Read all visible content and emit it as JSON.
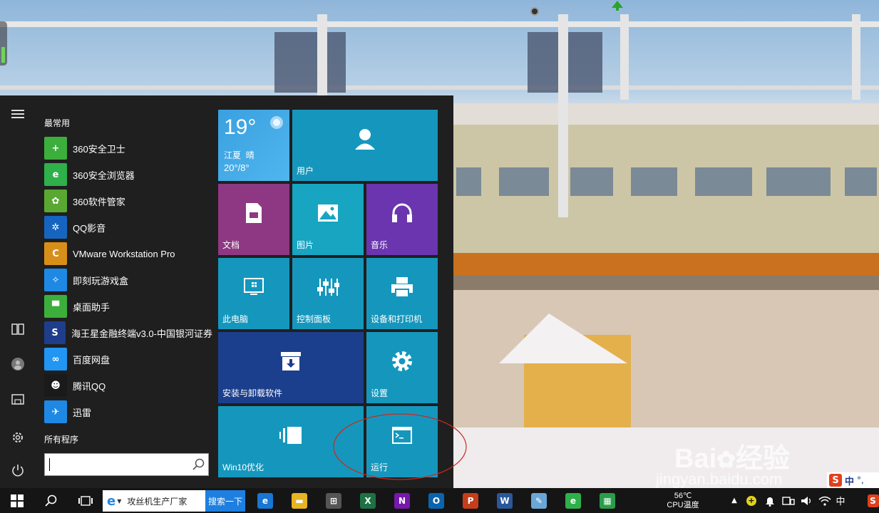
{
  "start_menu": {
    "most_used_heading": "最常用",
    "all_programs_label": "所有程序",
    "apps": [
      {
        "label": "360安全卫士",
        "icon": "360-safe-guard-icon",
        "color": "#3cae3c",
        "glyph": "+"
      },
      {
        "label": "360安全浏览器",
        "icon": "360-browser-icon",
        "color": "#2fb04a",
        "glyph": "e"
      },
      {
        "label": "360软件管家",
        "icon": "360-software-manager-icon",
        "color": "#5aa832",
        "glyph": "✿"
      },
      {
        "label": "QQ影音",
        "icon": "qq-player-icon",
        "color": "#1565c0",
        "glyph": "✲"
      },
      {
        "label": "VMware Workstation Pro",
        "icon": "vmware-icon",
        "color": "#d88f1a",
        "glyph": "C"
      },
      {
        "label": "即刻玩游戏盒",
        "icon": "game-box-icon",
        "color": "#1e88e5",
        "glyph": "✧"
      },
      {
        "label": "桌面助手",
        "icon": "desktop-assistant-icon",
        "color": "#3cae3c",
        "glyph": "▀"
      },
      {
        "label": "海王星金融终端v3.0-中国银河证券",
        "icon": "neptune-finance-icon",
        "color": "#1e3e8c",
        "glyph": "S"
      },
      {
        "label": "百度网盘",
        "icon": "baidu-netdisk-icon",
        "color": "#2196f3",
        "glyph": "∞"
      },
      {
        "label": "腾讯QQ",
        "icon": "tencent-qq-icon",
        "color": "#1a1a1a",
        "glyph": "☻"
      },
      {
        "label": "迅雷",
        "icon": "xunlei-icon",
        "color": "#1e88e5",
        "glyph": "✈"
      }
    ],
    "search_value": ""
  },
  "tiles": {
    "weather": {
      "temp": "19°",
      "city": "江夏",
      "condition": "晴",
      "range": "20°/8°"
    },
    "user": "用户",
    "documents": "文档",
    "pictures": "图片",
    "music": "音乐",
    "this_pc": "此电脑",
    "control_panel": "控制面板",
    "devices_printers": "设备和打印机",
    "install_uninstall": "安装与卸载软件",
    "settings": "设置",
    "win10_optimize": "Win10优化",
    "run": "运行"
  },
  "taskbar": {
    "ie_label": "攻丝机生产厂家",
    "search_button": "搜索一下",
    "cpu_temp": "56℃",
    "cpu_label": "CPU温度",
    "ime_label": "中"
  },
  "watermark": {
    "site": "jingyan.baidu.com",
    "brand": "Bai",
    "brand2": "经验"
  },
  "ime_bar": "中"
}
